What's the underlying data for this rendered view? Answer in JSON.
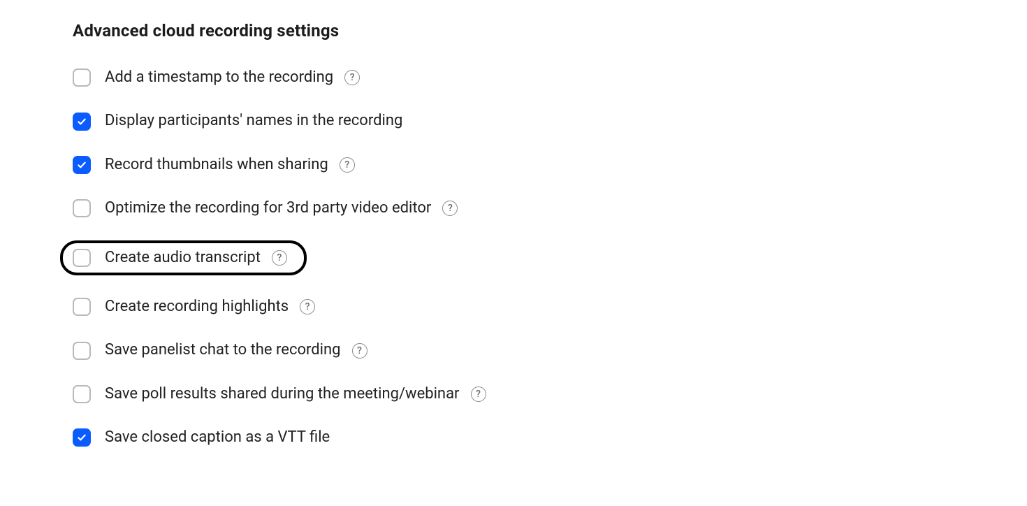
{
  "section_title": "Advanced cloud recording settings",
  "options": [
    {
      "id": "timestamp",
      "label": "Add a timestamp to the recording",
      "checked": false,
      "has_help": true,
      "highlighted": false
    },
    {
      "id": "participant-names",
      "label": "Display participants' names in the recording",
      "checked": true,
      "has_help": false,
      "highlighted": false
    },
    {
      "id": "thumbnails",
      "label": "Record thumbnails when sharing",
      "checked": true,
      "has_help": true,
      "highlighted": false
    },
    {
      "id": "optimize-3rd-party",
      "label": "Optimize the recording for 3rd party video editor",
      "checked": false,
      "has_help": true,
      "highlighted": false
    },
    {
      "id": "audio-transcript",
      "label": "Create audio transcript",
      "checked": false,
      "has_help": true,
      "highlighted": true
    },
    {
      "id": "highlights",
      "label": "Create recording highlights",
      "checked": false,
      "has_help": true,
      "highlighted": false
    },
    {
      "id": "panelist-chat",
      "label": "Save panelist chat to the recording",
      "checked": false,
      "has_help": true,
      "highlighted": false
    },
    {
      "id": "poll-results",
      "label": "Save poll results shared during the meeting/webinar",
      "checked": false,
      "has_help": true,
      "highlighted": false
    },
    {
      "id": "closed-caption-vtt",
      "label": "Save closed caption as a VTT file",
      "checked": true,
      "has_help": false,
      "highlighted": false
    }
  ]
}
